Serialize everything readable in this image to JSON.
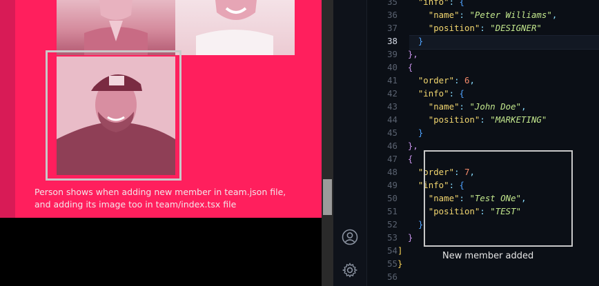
{
  "preview": {
    "caption_line1": "Person shows when adding new member in team.json file,",
    "caption_line2": "and adding its image too in team/index.tsx file",
    "accent_color": "#ff1f5d"
  },
  "editor": {
    "active_line": 38,
    "lines": [
      {
        "no": 35,
        "indent": "    ",
        "key": "\"info\"",
        "sep": ": ",
        "open": "{"
      },
      {
        "no": 36,
        "indent": "      ",
        "key": "\"name\"",
        "sep": ": ",
        "str": "\"Peter Williams\"",
        "tail": ","
      },
      {
        "no": 37,
        "indent": "      ",
        "key": "\"position\"",
        "sep": ": ",
        "str": "\"DESIGNER\""
      },
      {
        "no": 38,
        "indent": "    ",
        "close": "}"
      },
      {
        "no": 39,
        "indent": "  ",
        "close": "},"
      },
      {
        "no": 40,
        "indent": "  ",
        "open": "{"
      },
      {
        "no": 41,
        "indent": "    ",
        "key": "\"order\"",
        "sep": ": ",
        "num": "6",
        "tail": ","
      },
      {
        "no": 42,
        "indent": "    ",
        "key": "\"info\"",
        "sep": ": ",
        "open": "{"
      },
      {
        "no": 43,
        "indent": "      ",
        "key": "\"name\"",
        "sep": ": ",
        "str": "\"John Doe\"",
        "tail": ","
      },
      {
        "no": 44,
        "indent": "      ",
        "key": "\"position\"",
        "sep": ": ",
        "str": "\"MARKETING\""
      },
      {
        "no": 45,
        "indent": "    ",
        "close": "}"
      },
      {
        "no": 46,
        "indent": "  ",
        "close": "},"
      },
      {
        "no": 47,
        "indent": "  ",
        "open": "{"
      },
      {
        "no": 48,
        "indent": "    ",
        "key": "\"order\"",
        "sep": ": ",
        "num": "7",
        "tail": ","
      },
      {
        "no": 49,
        "indent": "    ",
        "key": "\"info\"",
        "sep": ": ",
        "open": "{"
      },
      {
        "no": 50,
        "indent": "      ",
        "key": "\"name\"",
        "sep": ": ",
        "str": "\"Test ONe\"",
        "tail": ","
      },
      {
        "no": 51,
        "indent": "      ",
        "key": "\"position\"",
        "sep": ": ",
        "str": "\"TEST\""
      },
      {
        "no": 52,
        "indent": "    ",
        "close": "}"
      },
      {
        "no": 53,
        "indent": "  ",
        "close": "}"
      },
      {
        "no": 54,
        "indent": "",
        "close": "]"
      },
      {
        "no": 55,
        "indent": "",
        "close": "}"
      },
      {
        "no": 56,
        "indent": ""
      }
    ],
    "highlight_caption": "New member added"
  },
  "icons": {
    "account": "account-icon",
    "settings": "gear-icon"
  }
}
